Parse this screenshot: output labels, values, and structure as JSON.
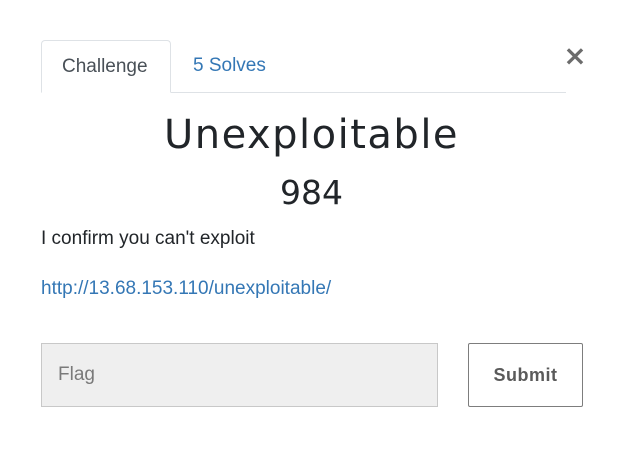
{
  "tabs": {
    "challenge_label": "Challenge",
    "solves_label": "5 Solves"
  },
  "close_symbol": "×",
  "challenge": {
    "name": "Unexploitable",
    "points": "984",
    "description": "I confirm you can't exploit",
    "link": "http://13.68.153.110/unexploitable/"
  },
  "form": {
    "flag_placeholder": "Flag",
    "flag_value": "",
    "submit_label": "Submit"
  },
  "colors": {
    "link": "#3477b5",
    "input_bg": "#efefef"
  }
}
